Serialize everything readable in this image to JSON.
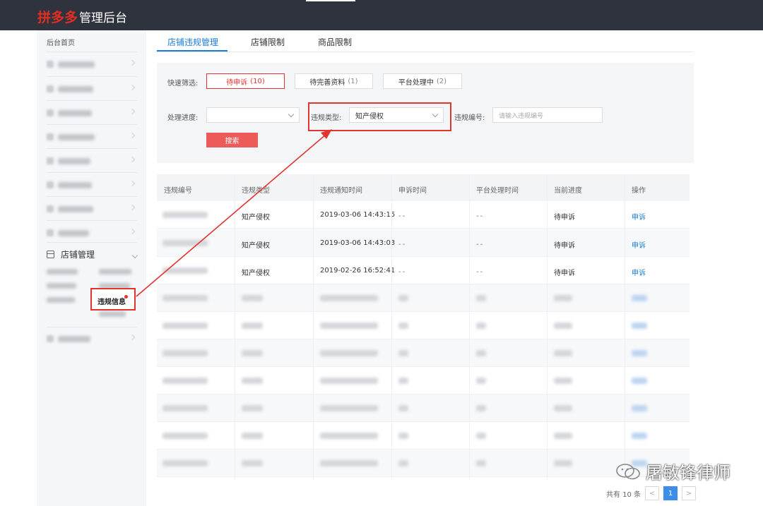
{
  "app": {
    "logo": "拼多多",
    "title": "管理后台"
  },
  "sidebar": {
    "home": "后台首页",
    "shop_mgmt": "店铺管理",
    "violation_info": "违规信息"
  },
  "tabs": [
    {
      "label": "店铺违规管理",
      "active": true
    },
    {
      "label": "店铺限制",
      "active": false
    },
    {
      "label": "商品限制",
      "active": false
    }
  ],
  "filters": {
    "quick_label": "快速筛选:",
    "quick": [
      {
        "label": "待申诉",
        "count": "(10)"
      },
      {
        "label": "待完善资料",
        "count": "(1)"
      },
      {
        "label": "平台处理中",
        "count": "(2)"
      }
    ],
    "progress_label": "处理进度:",
    "progress_value": "",
    "type_label": "违规类型:",
    "type_value": "知产侵权",
    "number_label": "违规编号:",
    "number_placeholder": "请输入违规编号",
    "search_label": "搜索"
  },
  "table": {
    "headers": [
      "违规编号",
      "违规类型",
      "违规通知时间",
      "申诉时间",
      "平台处理时间",
      "当前进度",
      "操作"
    ],
    "rows": [
      {
        "type": "知产侵权",
        "notice_time": "2019-03-06 14:43:15",
        "appeal_time": "--",
        "platform_time": "--",
        "status": "待申诉",
        "action": "申诉"
      },
      {
        "type": "知产侵权",
        "notice_time": "2019-03-06 14:43:03",
        "appeal_time": "--",
        "platform_time": "--",
        "status": "待申诉",
        "action": "申诉"
      },
      {
        "type": "知产侵权",
        "notice_time": "2019-02-26 16:52:41",
        "appeal_time": "--",
        "platform_time": "--",
        "status": "待申诉",
        "action": "申诉"
      }
    ]
  },
  "pagination": {
    "total": "共有 10 条",
    "current": "1",
    "prev": "<",
    "next": ">"
  },
  "watermark": {
    "text": "屠敏锋律师"
  },
  "colors": {
    "brand_red": "#e02e24",
    "accent_blue": "#1a7cd8",
    "highlight_red": "#e3342f"
  }
}
